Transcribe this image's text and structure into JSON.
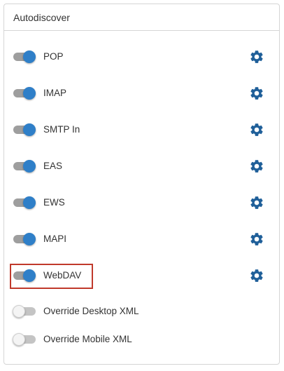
{
  "panel": {
    "title": "Autodiscover"
  },
  "services": [
    {
      "label": "POP",
      "enabled": true,
      "has_settings": true
    },
    {
      "label": "IMAP",
      "enabled": true,
      "has_settings": true
    },
    {
      "label": "SMTP In",
      "enabled": true,
      "has_settings": true
    },
    {
      "label": "EAS",
      "enabled": true,
      "has_settings": true
    },
    {
      "label": "EWS",
      "enabled": true,
      "has_settings": true
    },
    {
      "label": "MAPI",
      "enabled": true,
      "has_settings": true
    },
    {
      "label": "WebDAV",
      "enabled": true,
      "has_settings": true
    },
    {
      "label": "Override Desktop XML",
      "enabled": false,
      "has_settings": false
    },
    {
      "label": "Override Mobile XML",
      "enabled": false,
      "has_settings": false
    }
  ],
  "colors": {
    "toggle_on": "#2f7fc8",
    "gear": "#1f5f99",
    "highlight": "#c0392b"
  },
  "icons": {
    "settings": "gear-icon"
  },
  "highlighted_item": "WebDAV"
}
